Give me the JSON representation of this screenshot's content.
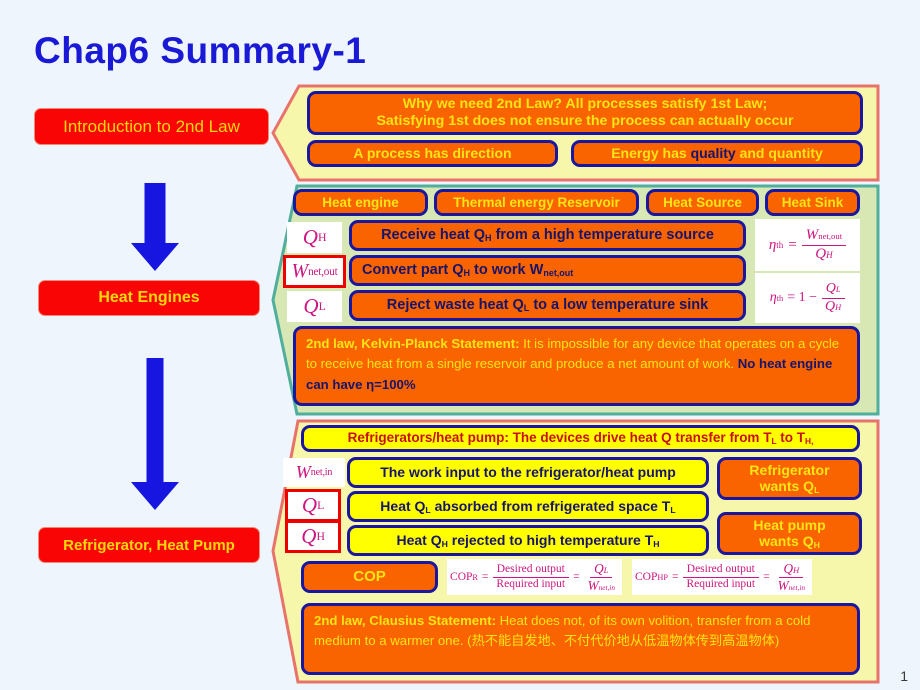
{
  "slide": {
    "title": "Chap6 Summary-1",
    "page_number": "1",
    "background_color": "#eef5fc"
  },
  "colors": {
    "title_blue": "#1a1ad6",
    "red_label": "#fa0505",
    "label_yellow_text": "#ffd70a",
    "orange_box": "#f96300",
    "navy_border": "#1a179e",
    "yellow_box": "#ffff00",
    "arrow_blue": "#1616e0",
    "pentagon_intro_fill": "#f7f7ab",
    "pentagon_intro_border": "#e8736a",
    "pentagon_he_fill": "#d7e8b4",
    "pentagon_he_border": "#4fae9c",
    "pentagon_rf_fill": "#f7f7ab",
    "pentagon_rf_border": "#e8736a",
    "formula_magenta": "#cc1580",
    "redbox_border": "#ee0000"
  },
  "left_column": {
    "items": [
      {
        "label": "Introduction  to 2nd  Law"
      },
      {
        "label": "Heat Engines"
      },
      {
        "label": "Refrigerator, Heat Pump"
      }
    ],
    "arrows": [
      {
        "name": "down-arrow-1"
      },
      {
        "name": "down-arrow-2"
      }
    ]
  },
  "intro_section": {
    "headline_line1": "Why we need 2nd Law?  All processes satisfy 1st Law;",
    "headline_line2": "Satisfying 1st does not ensure the process can actually occur",
    "boxes": [
      {
        "label": "A process has direction"
      }
    ],
    "quality_box": {
      "pre": "Energy has ",
      "emphasis": "quality",
      "post": " and quantity"
    }
  },
  "heat_engine_section": {
    "terms": [
      {
        "label": "Heat engine"
      },
      {
        "label": "Thermal energy Reservoir"
      },
      {
        "label": "Heat Source"
      },
      {
        "label": "Heat Sink"
      }
    ],
    "symbols": [
      {
        "main": "Q",
        "sub": "H",
        "boxed": false
      },
      {
        "main": "W",
        "sub": "net,out",
        "boxed": true
      },
      {
        "main": "Q",
        "sub": "L",
        "boxed": false
      }
    ],
    "statements": [
      {
        "pre": "Receive  heat Q",
        "sub": "H",
        "post": " from a high temperature source"
      },
      {
        "pre": "Convert part Q",
        "sub": "H",
        "post": " to work W",
        "sub2": "net,out",
        "post2": ""
      },
      {
        "pre": "Reject waste heat Q",
        "sub": "L",
        "post": " to a low temperature sink"
      }
    ],
    "efficiency_formula_1": {
      "lhs": "η",
      "lhs_sub": "th",
      "eq": "=",
      "numerator": "W",
      "numerator_sub": "net,out",
      "denominator": "Q",
      "denominator_sub": "H"
    },
    "efficiency_formula_2": {
      "lhs": "η",
      "lhs_sub": "th",
      "eq": "= 1  −",
      "numerator": "Q",
      "numerator_sub": "L",
      "denominator": "Q",
      "denominator_sub": "H"
    },
    "kelvin_planck": {
      "title": "2nd law, Kelvin-Planck  Statement:",
      "body": " It is impossible  for any  device that operates on a cycle  to receive heat from  a single  reservoir and  produce  a net amount  of work.",
      "conclusion": "No heat engine can have η=100%"
    }
  },
  "refrigerator_section": {
    "headline": {
      "pre": "Refrigerators/heat  pump:  The devices drive heat Q transfer from  T",
      "sub1": "L",
      "mid": " to T",
      "sub2": "H,"
    },
    "symbols": [
      {
        "main": "W",
        "sub": "net,in",
        "boxed": false
      },
      {
        "main": "Q",
        "sub": "L",
        "boxed": true
      },
      {
        "main": "Q",
        "sub": "H",
        "boxed": true
      }
    ],
    "statements": [
      {
        "pre": "The work input to the refrigerator/heat pump",
        "sub": "",
        "post": ""
      },
      {
        "pre": "Heat Q",
        "sub": "L",
        "post": " absorbed from refrigerated space T",
        "sub2": "L"
      },
      {
        "pre": "Heat Q",
        "sub": "H",
        "post": " rejected to high temperature T",
        "sub2": "H"
      }
    ],
    "wants": [
      {
        "line1": "Refrigerator",
        "line2": "wants  Q",
        "sub": "L"
      },
      {
        "line1": "Heat pump",
        "line2": "wants  Q",
        "sub": "H"
      }
    ],
    "cop_label": "COP",
    "cop_formulas": [
      {
        "lhs": "COP",
        "lhs_sub": "R",
        "numerator": "Desired output",
        "denominator": "Required input",
        "rhs_num": "Q",
        "rhs_num_sub": "L",
        "rhs_den": "W",
        "rhs_den_sub": "net,in"
      },
      {
        "lhs": "COP",
        "lhs_sub": "HP",
        "numerator": "Desired output",
        "denominator": "Required input",
        "rhs_num": "Q",
        "rhs_num_sub": "H",
        "rhs_den": "W",
        "rhs_den_sub": "net,in"
      }
    ],
    "clausius": {
      "title": "2nd law, Clausius  Statement:",
      "body": " Heat does not, of its own  volition,  transfer from  a cold  medium  to a warmer  one. (热不能自发地、不付代价地从低温物体传到高温物体)"
    }
  }
}
